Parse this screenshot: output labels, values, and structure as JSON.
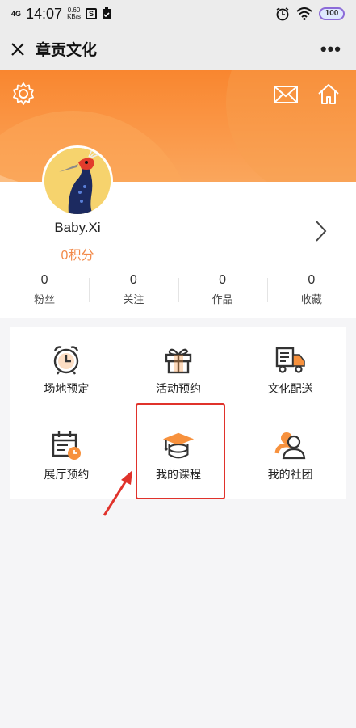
{
  "status_bar": {
    "network": "4G",
    "time": "14:07",
    "speed_value": "0.60",
    "speed_unit": "KB/s",
    "battery": "100"
  },
  "nav": {
    "title": "章贡文化",
    "more": "•••"
  },
  "profile": {
    "username": "Baby.Xi",
    "points": "0积分"
  },
  "stats": [
    {
      "value": "0",
      "label": "粉丝"
    },
    {
      "value": "0",
      "label": "关注"
    },
    {
      "value": "0",
      "label": "作品"
    },
    {
      "value": "0",
      "label": "收藏"
    }
  ],
  "menu": [
    {
      "label": "场地预定",
      "icon": "alarm-clock-icon"
    },
    {
      "label": "活动预约",
      "icon": "gift-icon"
    },
    {
      "label": "文化配送",
      "icon": "delivery-truck-icon"
    },
    {
      "label": "展厅预约",
      "icon": "calendar-clock-icon"
    },
    {
      "label": "我的课程",
      "icon": "graduation-cap-icon"
    },
    {
      "label": "我的社团",
      "icon": "people-icon"
    }
  ],
  "colors": {
    "accent_orange": "#f7913d",
    "highlight_red": "#e0322b",
    "points_orange": "#f28a4a"
  }
}
